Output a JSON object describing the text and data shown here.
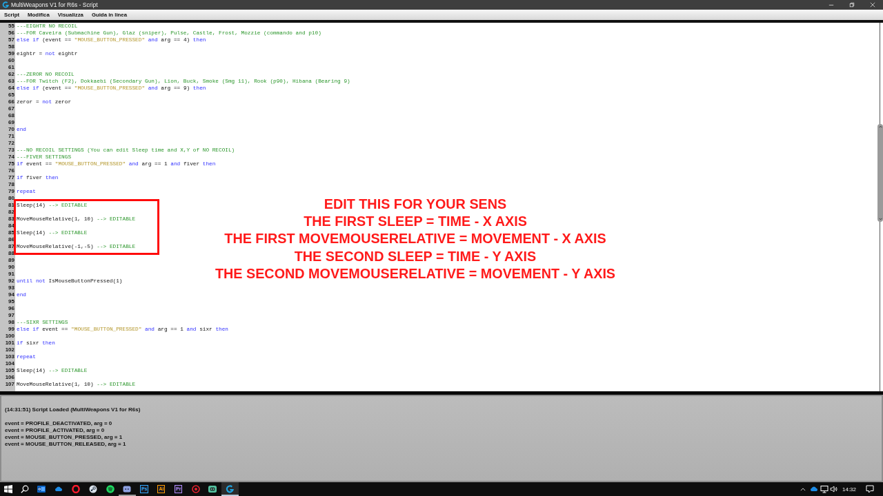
{
  "window": {
    "title": "MultiWeapons V1 for R6s - Script"
  },
  "menu": [
    "Script",
    "Modifica",
    "Visualizza",
    "Guida in linea"
  ],
  "editor": {
    "lines": [
      {
        "number": "55",
        "tokens": [
          {
            "kind": "comment",
            "text": "---EIGHTR NO RECOIL"
          }
        ]
      },
      {
        "number": "56",
        "tokens": [
          {
            "kind": "comment",
            "text": "---FOR Caveira (Submachine Gun), Glaz (sniper), Pulse, Castle, Frost, Mozzie (commando and p10)"
          }
        ]
      },
      {
        "number": "57",
        "tokens": [
          {
            "kind": "keyword",
            "text": "else if"
          },
          {
            "kind": "plain",
            "text": " (event == "
          },
          {
            "kind": "string",
            "text": "\"MOUSE_BUTTON_PRESSED\""
          },
          {
            "kind": "keyword",
            "text": " and"
          },
          {
            "kind": "plain",
            "text": " arg == 4) "
          },
          {
            "kind": "keyword",
            "text": "then"
          }
        ]
      },
      {
        "number": "58"
      },
      {
        "number": "59",
        "tokens": [
          {
            "kind": "plain",
            "text": "eightr = "
          },
          {
            "kind": "keyword",
            "text": "not"
          },
          {
            "kind": "plain",
            "text": " eightr"
          }
        ]
      },
      {
        "number": "60"
      },
      {
        "number": "61"
      },
      {
        "number": "62",
        "tokens": [
          {
            "kind": "comment",
            "text": "---ZEROR NO RECOIL"
          }
        ]
      },
      {
        "number": "63",
        "tokens": [
          {
            "kind": "comment",
            "text": "---FOR Twitch (F2), Dokkaebi (Secondary Gun), Lion, Buck, Smoke (Smg 11), Rook (p90), Hibana (Bearing 9)"
          }
        ]
      },
      {
        "number": "64",
        "tokens": [
          {
            "kind": "keyword",
            "text": "else if"
          },
          {
            "kind": "plain",
            "text": " (event == "
          },
          {
            "kind": "string",
            "text": "\"MOUSE_BUTTON_PRESSED\""
          },
          {
            "kind": "keyword",
            "text": " and"
          },
          {
            "kind": "plain",
            "text": " arg == 9) "
          },
          {
            "kind": "keyword",
            "text": "then"
          }
        ]
      },
      {
        "number": "65"
      },
      {
        "number": "66",
        "tokens": [
          {
            "kind": "plain",
            "text": "zeror = "
          },
          {
            "kind": "keyword",
            "text": "not"
          },
          {
            "kind": "plain",
            "text": " zeror"
          }
        ]
      },
      {
        "number": "67"
      },
      {
        "number": "68"
      },
      {
        "number": "69"
      },
      {
        "number": "70",
        "tokens": [
          {
            "kind": "keyword",
            "text": "end"
          }
        ]
      },
      {
        "number": "71"
      },
      {
        "number": "72"
      },
      {
        "number": "73",
        "tokens": [
          {
            "kind": "comment",
            "text": "---NO RECOIL SETTINGS (You can edit Sleep time and X,Y of NO RECOIL)"
          }
        ]
      },
      {
        "number": "74",
        "tokens": [
          {
            "kind": "comment",
            "text": "---FIVER SETTINGS"
          }
        ]
      },
      {
        "number": "75",
        "tokens": [
          {
            "kind": "keyword",
            "text": "if"
          },
          {
            "kind": "plain",
            "text": " event == "
          },
          {
            "kind": "string",
            "text": "\"MOUSE_BUTTON_PRESSED\""
          },
          {
            "kind": "keyword",
            "text": " and"
          },
          {
            "kind": "plain",
            "text": " arg == 1 "
          },
          {
            "kind": "keyword",
            "text": "and"
          },
          {
            "kind": "plain",
            "text": " fiver "
          },
          {
            "kind": "keyword",
            "text": "then"
          }
        ]
      },
      {
        "number": "76"
      },
      {
        "number": "77",
        "tokens": [
          {
            "kind": "keyword",
            "text": "if"
          },
          {
            "kind": "plain",
            "text": " fiver "
          },
          {
            "kind": "keyword",
            "text": "then"
          }
        ]
      },
      {
        "number": "78"
      },
      {
        "number": "79",
        "tokens": [
          {
            "kind": "keyword",
            "text": "repeat"
          }
        ]
      },
      {
        "number": "80"
      },
      {
        "number": "81",
        "tokens": [
          {
            "kind": "plain",
            "text": "Sleep(14) "
          },
          {
            "kind": "comment",
            "text": "--> EDITABLE"
          }
        ]
      },
      {
        "number": "82"
      },
      {
        "number": "83",
        "tokens": [
          {
            "kind": "plain",
            "text": "MoveMouseRelative(1, 10) "
          },
          {
            "kind": "comment",
            "text": "--> EDITABLE"
          }
        ]
      },
      {
        "number": "84"
      },
      {
        "number": "85",
        "tokens": [
          {
            "kind": "plain",
            "text": "Sleep(14) "
          },
          {
            "kind": "comment",
            "text": "--> EDITABLE"
          }
        ]
      },
      {
        "number": "86"
      },
      {
        "number": "87",
        "tokens": [
          {
            "kind": "plain",
            "text": "MoveMouseRelative(-1,-5) "
          },
          {
            "kind": "comment",
            "text": "--> EDITABLE"
          }
        ]
      },
      {
        "number": "88"
      },
      {
        "number": "89"
      },
      {
        "number": "90"
      },
      {
        "number": "91"
      },
      {
        "number": "92",
        "tokens": [
          {
            "kind": "keyword",
            "text": "until not"
          },
          {
            "kind": "plain",
            "text": " IsMouseButtonPressed(1)"
          }
        ]
      },
      {
        "number": "93"
      },
      {
        "number": "94",
        "tokens": [
          {
            "kind": "keyword",
            "text": "end"
          }
        ]
      },
      {
        "number": "95"
      },
      {
        "number": "96"
      },
      {
        "number": "97"
      },
      {
        "number": "98",
        "tokens": [
          {
            "kind": "comment",
            "text": "---SIXR SETTINGS"
          }
        ]
      },
      {
        "number": "99",
        "tokens": [
          {
            "kind": "keyword",
            "text": "else if"
          },
          {
            "kind": "plain",
            "text": " event == "
          },
          {
            "kind": "string",
            "text": "\"MOUSE_BUTTON_PRESSED\""
          },
          {
            "kind": "keyword",
            "text": " and"
          },
          {
            "kind": "plain",
            "text": " arg == 1 "
          },
          {
            "kind": "keyword",
            "text": "and"
          },
          {
            "kind": "plain",
            "text": " sixr "
          },
          {
            "kind": "keyword",
            "text": "then"
          }
        ]
      },
      {
        "number": "100"
      },
      {
        "number": "101",
        "tokens": [
          {
            "kind": "keyword",
            "text": "if"
          },
          {
            "kind": "plain",
            "text": " sixr "
          },
          {
            "kind": "keyword",
            "text": "then"
          }
        ]
      },
      {
        "number": "102"
      },
      {
        "number": "103",
        "tokens": [
          {
            "kind": "keyword",
            "text": "repeat"
          }
        ]
      },
      {
        "number": "104"
      },
      {
        "number": "105",
        "tokens": [
          {
            "kind": "plain",
            "text": "Sleep(14) "
          },
          {
            "kind": "comment",
            "text": "--> EDITABLE"
          }
        ]
      },
      {
        "number": "106"
      },
      {
        "number": "107",
        "tokens": [
          {
            "kind": "plain",
            "text": "MoveMouseRelative(1, 10) "
          },
          {
            "kind": "comment",
            "text": "--> EDITABLE"
          }
        ]
      }
    ]
  },
  "annotation": {
    "lines": [
      "EDIT THIS FOR YOUR SENS",
      "THE FIRST SLEEP = TIME - X AXIS",
      "THE FIRST MOVEMOUSERELATIVE = MOVEMENT - X AXIS",
      "THE SECOND SLEEP = TIME - Y AXIS",
      "THE SECOND MOVEMOUSERELATIVE = MOVEMENT - Y AXIS"
    ]
  },
  "console": {
    "header": "(14:31:51) Script Loaded (MultiWeapons V1 for R6s)",
    "events": [
      "event = PROFILE_DEACTIVATED, arg = 0",
      "event = PROFILE_ACTIVATED, arg = 0",
      "event = MOUSE_BUTTON_PRESSED, arg = 1",
      "event = MOUSE_BUTTON_RELEASED, arg = 1"
    ]
  },
  "taskbar": {
    "apps": [
      {
        "kind": "mail",
        "running": false,
        "selected": false
      },
      {
        "kind": "cloud",
        "running": false,
        "selected": false
      },
      {
        "kind": "ring",
        "running": false,
        "selected": false
      },
      {
        "kind": "wheel",
        "running": false,
        "selected": false
      },
      {
        "kind": "waves",
        "running": false,
        "selected": false
      },
      {
        "kind": "gamepad",
        "running": true,
        "selected": false
      },
      {
        "kind": "tile",
        "label": "Ps",
        "color": "#31a8ff",
        "running": false,
        "selected": false
      },
      {
        "kind": "tile",
        "label": "Ai",
        "color": "#ff9a00",
        "running": false,
        "selected": false
      },
      {
        "kind": "tile",
        "label": "Pr",
        "color": "#b48cff",
        "running": false,
        "selected": false
      },
      {
        "kind": "target",
        "running": false,
        "selected": false
      },
      {
        "kind": "chat",
        "running": false,
        "selected": false
      },
      {
        "kind": "hook",
        "running": true,
        "selected": true
      }
    ],
    "clock": "14:32"
  }
}
